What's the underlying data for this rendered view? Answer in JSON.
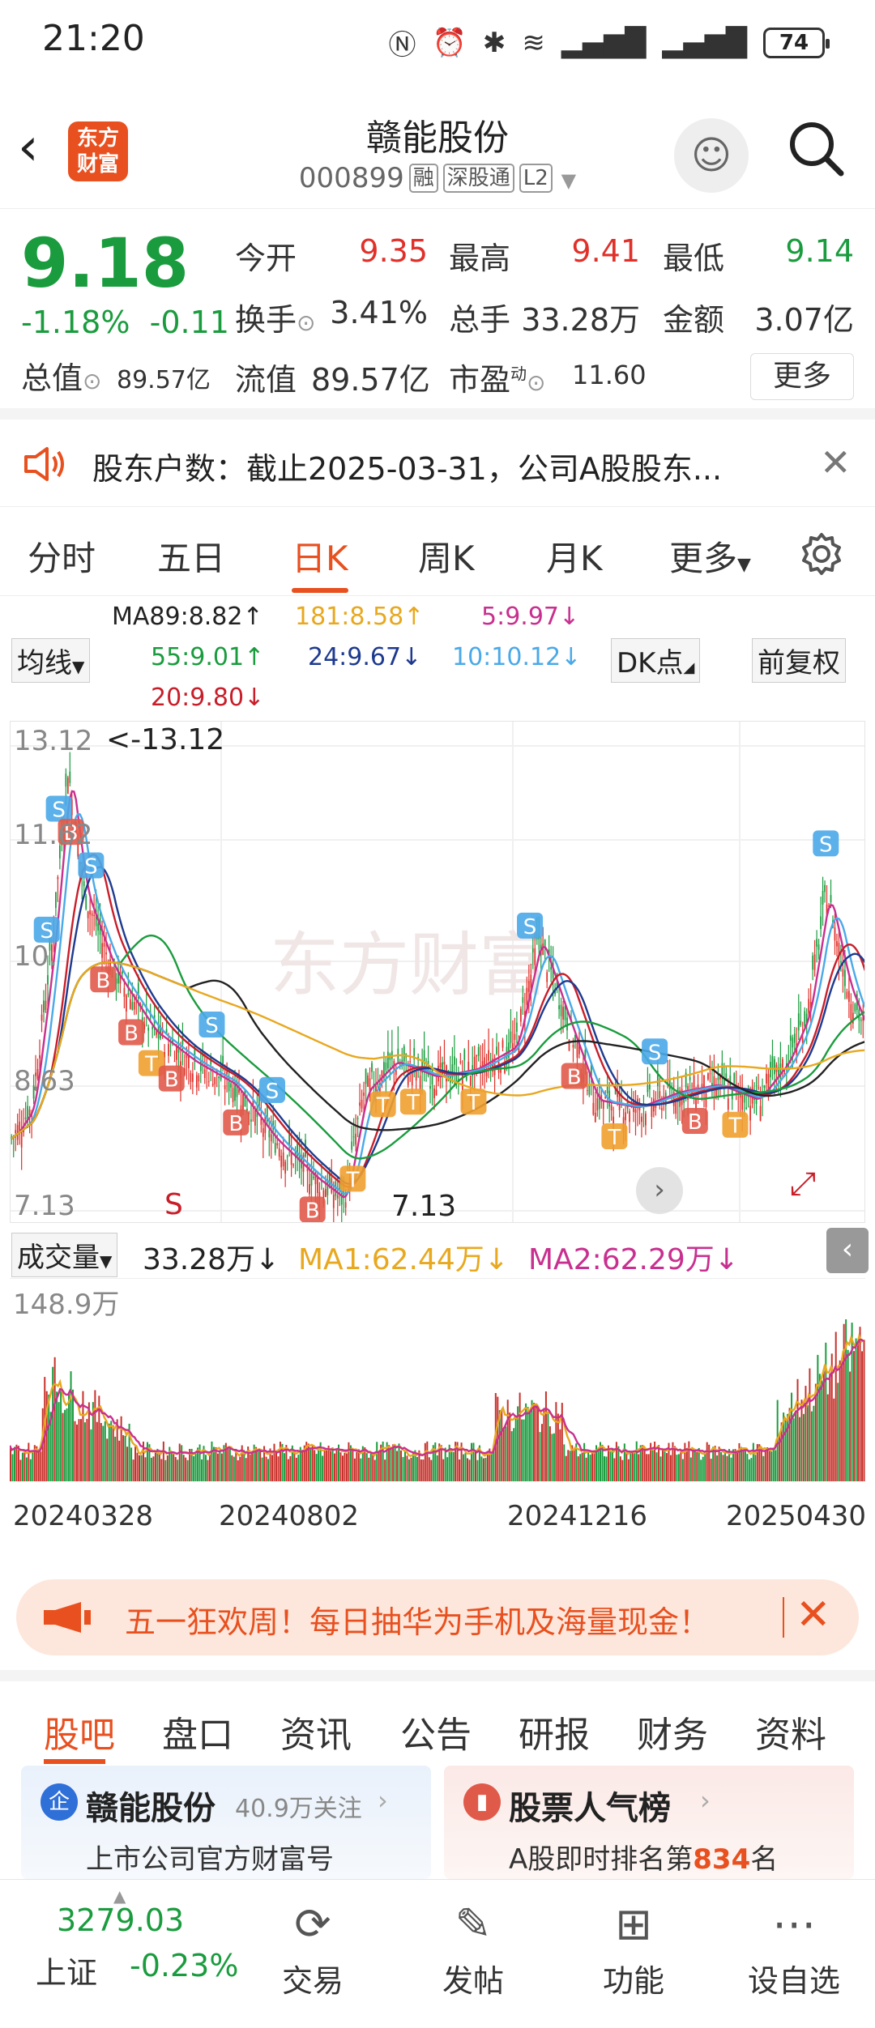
{
  "status_bar": {
    "time": "21:20",
    "battery": "74"
  },
  "header": {
    "logo": "东方财富",
    "title": "赣能股份",
    "code": "000899",
    "tags": [
      "融",
      "深股通",
      "L2"
    ]
  },
  "quote": {
    "price": "9.18",
    "change_pct": "-1.18%",
    "change": "-0.11",
    "open_label": "今开",
    "open": "9.35",
    "high_label": "最高",
    "high": "9.41",
    "low_label": "最低",
    "low": "9.14",
    "turnover_label": "换手",
    "turnover": "3.41%",
    "volume_label": "总手",
    "volume": "33.28万",
    "amount_label": "金额",
    "amount": "3.07亿",
    "mktcap_label": "总值",
    "mktcap": "89.57亿",
    "float_label": "流值",
    "float": "89.57亿",
    "pe_label": "市盈",
    "pe_sup": "动",
    "pe": "11.60",
    "more": "更多"
  },
  "notice": {
    "text": "股东户数：截止2025-03-31，公司A股股东..."
  },
  "chart_tabs": {
    "items": [
      "分时",
      "五日",
      "日K",
      "周K",
      "月K",
      "更多"
    ],
    "active": "日K"
  },
  "ma_legend": {
    "items": [
      {
        "label": "MA89:8.82↑",
        "color": "#222222"
      },
      {
        "label": "181:8.58↑",
        "color": "#e8a81f"
      },
      {
        "label": "5:9.97↓",
        "color": "#c8308f"
      },
      {
        "label": "55:9.01↑",
        "color": "#1a9c3e"
      },
      {
        "label": "24:9.67↓",
        "color": "#1e3a8f"
      },
      {
        "label": "10:10.12↓",
        "color": "#4aa9e8"
      },
      {
        "label": "20:9.80↓",
        "color": "#c81e2a"
      }
    ],
    "ma_button": "均线",
    "dk_button": "DK点",
    "adj_button": "前复权"
  },
  "kline": {
    "axis": [
      "13.12",
      "11.62",
      "10.",
      "8.63",
      "7.13"
    ],
    "max_label": "<-13.12",
    "min_label": "7.13",
    "watermark": "东方财富",
    "s_label": "S"
  },
  "volume": {
    "selector": "成交量",
    "value": "33.28万↓",
    "ma1": "MA1:62.44万↓",
    "ma2": "MA2:62.29万↓",
    "axis_max": "148.9万"
  },
  "dates": [
    "20240328",
    "20240802",
    "20241216",
    "20250430"
  ],
  "banner": {
    "text": "五一狂欢周！每日抽华为手机及海量现金！"
  },
  "section_tabs": {
    "items": [
      "股吧",
      "盘口",
      "资讯",
      "公告",
      "研报",
      "财务",
      "资料"
    ],
    "active": "股吧"
  },
  "cards": {
    "company": {
      "badge": "企",
      "name": "赣能股份",
      "followers": "40.9万关注",
      "subtitle": "上市公司官方财富号"
    },
    "ranking": {
      "name": "股票人气榜",
      "prefix": "A股即时排名第",
      "rank": "834",
      "suffix": "名"
    }
  },
  "bottom_nav": {
    "index_value": "3279.03",
    "index_name": "上证",
    "index_change": "-0.23%",
    "items": [
      {
        "label": "交易",
        "icon": "trade-icon"
      },
      {
        "label": "发帖",
        "icon": "post-icon"
      },
      {
        "label": "功能",
        "icon": "apps-icon"
      },
      {
        "label": "设自选",
        "icon": "add-favorite-icon"
      }
    ]
  },
  "colors": {
    "accent": "#e8501f",
    "up": "#e0302a",
    "down": "#1a9c3e"
  }
}
